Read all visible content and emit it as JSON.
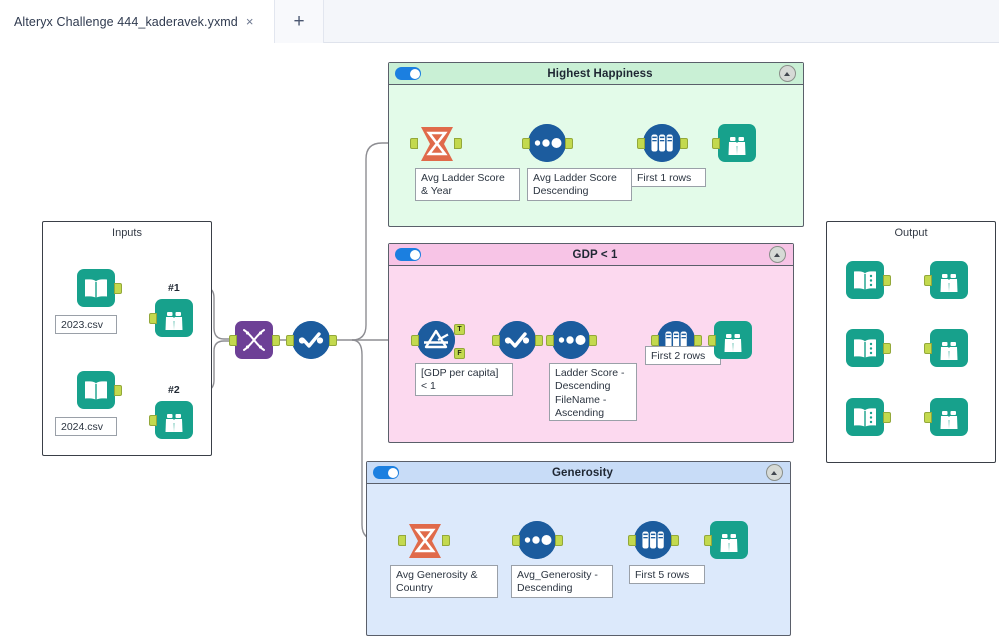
{
  "window": {
    "tab": {
      "title": "Alteryx Challenge 444_kaderavek.yxmd",
      "close_icon": "×"
    },
    "new_tab_label": "+"
  },
  "canvas": {
    "colors": {
      "container_green_fill": "#e3fbe9",
      "container_green_header": "#c9f0d5",
      "container_pink_fill": "#fcd9ef",
      "container_pink_header": "#f7c4e6",
      "container_blue_fill": "#dce9fb",
      "container_blue_header": "#c8dcf7",
      "tool_teal": "#17a18c",
      "tool_blue": "#1c5c9e",
      "tool_orange": "#e06a4a",
      "tool_purple": "#6d4096",
      "anchor_green": "#c3d94e",
      "wire_gray": "#8d8d92",
      "toggle_on": "#1b7fe0"
    },
    "containers": [
      {
        "id": "inputs",
        "title": "Inputs",
        "type": "plain"
      },
      {
        "id": "highest-happiness",
        "title": "Highest Happiness",
        "type": "titled",
        "enabled": true,
        "collapse_icon": "chevron-up"
      },
      {
        "id": "gdp",
        "title": "GDP < 1",
        "type": "titled",
        "enabled": true,
        "collapse_icon": "chevron-up"
      },
      {
        "id": "generosity",
        "title": "Generosity",
        "type": "titled",
        "enabled": true,
        "collapse_icon": "chevron-up"
      },
      {
        "id": "output",
        "title": "Output",
        "type": "plain"
      }
    ],
    "tools": {
      "input_2023": {
        "icon": "input-data-icon",
        "label": "2023.csv"
      },
      "input_2024": {
        "icon": "input-data-icon",
        "label": "2024.csv"
      },
      "browse_2023": {
        "icon": "browse-icon"
      },
      "browse_2024": {
        "icon": "browse-icon"
      },
      "union": {
        "icon": "union-icon"
      },
      "select_main": {
        "icon": "select-icon"
      },
      "hh_summarize": {
        "icon": "summarize-icon",
        "label": "Avg Ladder Score\n& Year"
      },
      "hh_sort": {
        "icon": "sort-icon",
        "label": "Avg Ladder Score\nDescending"
      },
      "hh_sample": {
        "icon": "sample-icon",
        "label": "First 1 rows"
      },
      "hh_browse": {
        "icon": "browse-icon"
      },
      "gdp_filter": {
        "icon": "filter-icon",
        "label": "[GDP per capita]\n< 1",
        "out_true": "T",
        "out_false": "F"
      },
      "gdp_select": {
        "icon": "select-icon"
      },
      "gdp_sort": {
        "icon": "sort-icon",
        "label": "Ladder Score -\nDescending\nFileName -\nAscending"
      },
      "gdp_sample": {
        "icon": "sample-icon",
        "label": "First 2 rows"
      },
      "gdp_browse": {
        "icon": "browse-icon"
      },
      "gen_summarize": {
        "icon": "summarize-icon",
        "label": "Avg Generosity &\nCountry"
      },
      "gen_sort": {
        "icon": "sort-icon",
        "label": "Avg_Generosity -\nDescending"
      },
      "gen_sample": {
        "icon": "sample-icon",
        "label": "First 5 rows"
      },
      "gen_browse": {
        "icon": "browse-icon"
      },
      "out_1": {
        "icon": "output-data-icon"
      },
      "out_browse_1": {
        "icon": "browse-icon"
      },
      "out_2": {
        "icon": "output-data-icon"
      },
      "out_browse_2": {
        "icon": "browse-icon"
      },
      "out_3": {
        "icon": "output-data-icon"
      },
      "out_browse_3": {
        "icon": "browse-icon"
      }
    },
    "connection_labels": {
      "union_in_1": "#1",
      "union_in_2": "#2"
    }
  }
}
